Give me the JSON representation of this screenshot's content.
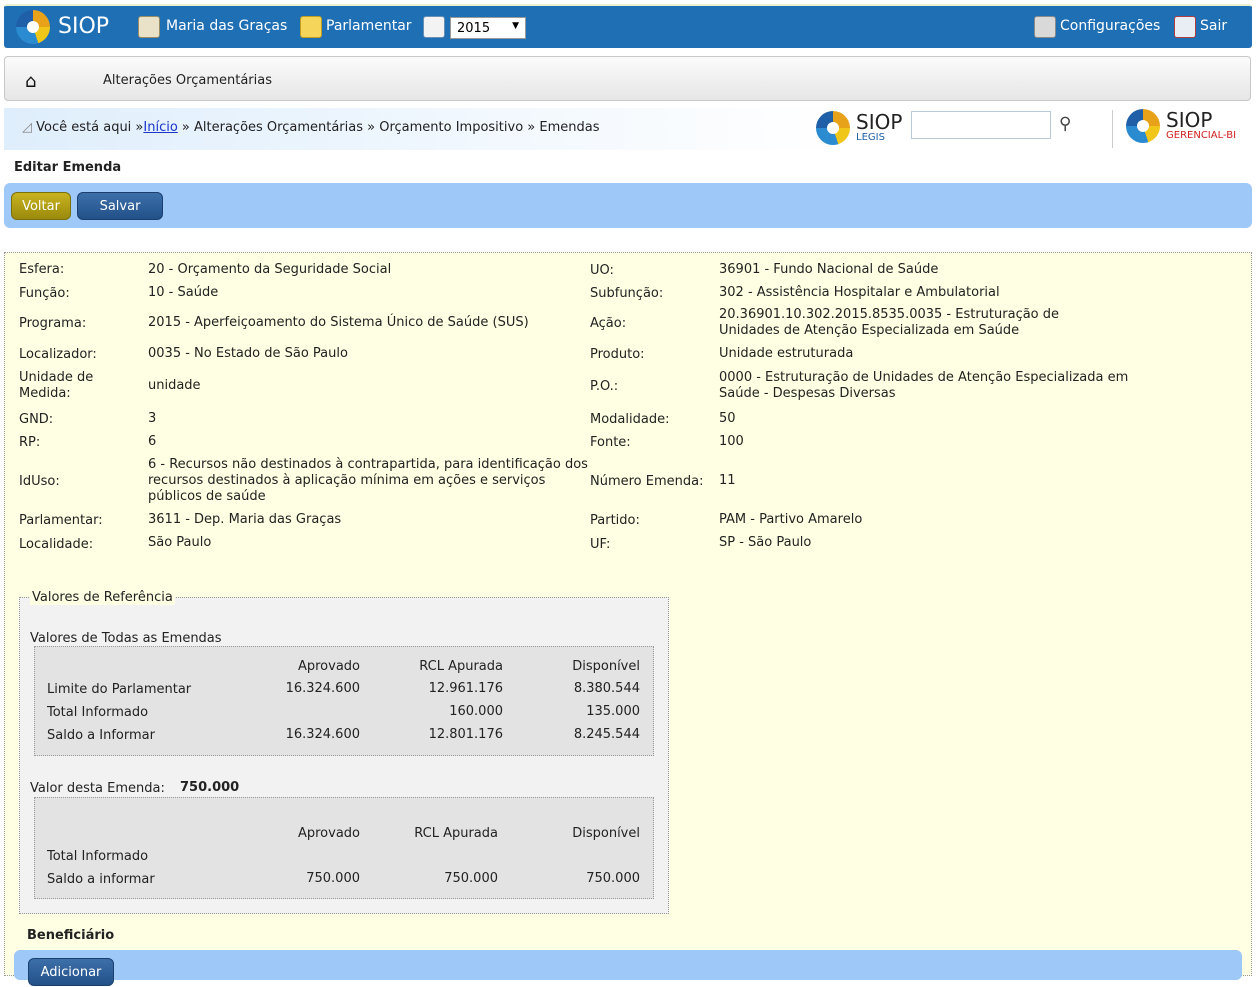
{
  "topbar": {
    "app_name": "SIOP",
    "user_name": "Maria das Graças",
    "role": "Parlamentar",
    "year": "2015",
    "config_label": "Configurações",
    "exit_label": "Sair"
  },
  "menu": {
    "item": "Alterações Orçamentárias"
  },
  "breadcrumb": {
    "prefix": "Você está aqui »",
    "home": "Início",
    "rest": " » Alterações Orçamentárias » Orçamento Impositivo » Emendas"
  },
  "logos": {
    "legis_title": "SIOP",
    "legis_sub": "LEGIS",
    "gerencial_title": "SIOP",
    "gerencial_sub": "GERENCIAL-BI"
  },
  "page_title": "Editar Emenda",
  "buttons": {
    "voltar": "Voltar",
    "salvar": "Salvar",
    "adicionar": "Adicionar"
  },
  "left_fields": [
    {
      "label": "Esfera:",
      "value": "20 - Orçamento da Seguridade Social"
    },
    {
      "label": "Função:",
      "value": "10 - Saúde"
    },
    {
      "label": "Programa:",
      "value": "2015 - Aperfeiçoamento do Sistema Único de Saúde (SUS)"
    },
    {
      "label": "Localizador:",
      "value": "0035 - No Estado de São Paulo"
    },
    {
      "label": "Unidade de Medida:",
      "value": "unidade"
    },
    {
      "label": "GND:",
      "value": "3"
    },
    {
      "label": "RP:",
      "value": "6"
    },
    {
      "label": "IdUso:",
      "value": "6 - Recursos não destinados à contrapartida, para identificação dos recursos destinados à aplicação mínima em ações e serviços públicos de saúde"
    },
    {
      "label": "Parlamentar:",
      "value": "3611 - Dep. Maria das Graças"
    },
    {
      "label": "Localidade:",
      "value": "São Paulo"
    }
  ],
  "right_fields": [
    {
      "label": "UO:",
      "value": "36901 - Fundo Nacional de Saúde"
    },
    {
      "label": "Subfunção:",
      "value": "302 - Assistência Hospitalar e Ambulatorial"
    },
    {
      "label": "Ação:",
      "value": "20.36901.10.302.2015.8535.0035 - Estruturação de Unidades de Atenção Especializada em Saúde"
    },
    {
      "label": "Produto:",
      "value": "Unidade estruturada"
    },
    {
      "label": "P.O.:",
      "value": "0000 - Estruturação de Unidades de Atenção Especializada em Saúde - Despesas Diversas"
    },
    {
      "label": "Modalidade:",
      "value": "50"
    },
    {
      "label": "Fonte:",
      "value": "100"
    },
    {
      "label": "Número Emenda:",
      "value": "11"
    },
    {
      "label": "Partido:",
      "value": "PAM - Partivo Amarelo"
    },
    {
      "label": "UF:",
      "value": "SP - São Paulo"
    }
  ],
  "referencia": {
    "legend": "Valores de Referência",
    "todas_title": "Valores de Todas as Emendas",
    "columns": [
      "Aprovado",
      "RCL Apurada",
      "Disponível"
    ],
    "todas_rows": [
      {
        "label": "Limite do Parlamentar",
        "aprovado": "16.324.600",
        "rcl": "12.961.176",
        "disponivel": "8.380.544"
      },
      {
        "label": "Total Informado",
        "aprovado": "",
        "rcl": "160.000",
        "disponivel": "135.000"
      },
      {
        "label": "Saldo a Informar",
        "aprovado": "16.324.600",
        "rcl": "12.801.176",
        "disponivel": "8.245.544"
      }
    ],
    "emenda_label": "Valor desta Emenda:",
    "emenda_value": "750.000",
    "emenda_rows": [
      {
        "label": "Total Informado",
        "aprovado": "",
        "rcl": "",
        "disponivel": ""
      },
      {
        "label": "Saldo a informar",
        "aprovado": "750.000",
        "rcl": "750.000",
        "disponivel": "750.000"
      }
    ]
  },
  "beneficiario_label": "Beneficiário"
}
